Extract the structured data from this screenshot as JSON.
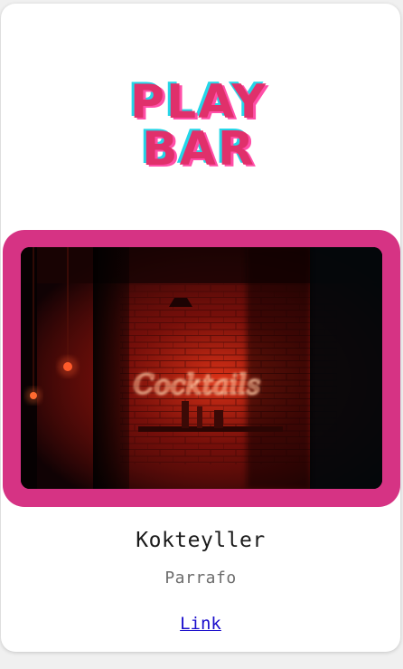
{
  "card": {
    "logo": {
      "line1": "PLAY",
      "line2": "BAR",
      "colors": {
        "main": "#e0306b",
        "cyan": "#24d6e8",
        "pink": "#ff4fa8"
      }
    },
    "image": {
      "neon_text": "Cocktails",
      "frame_color": "#d63384"
    },
    "title": "Kokteyller",
    "paragraph": "Parrafo",
    "link_label": "Link"
  }
}
